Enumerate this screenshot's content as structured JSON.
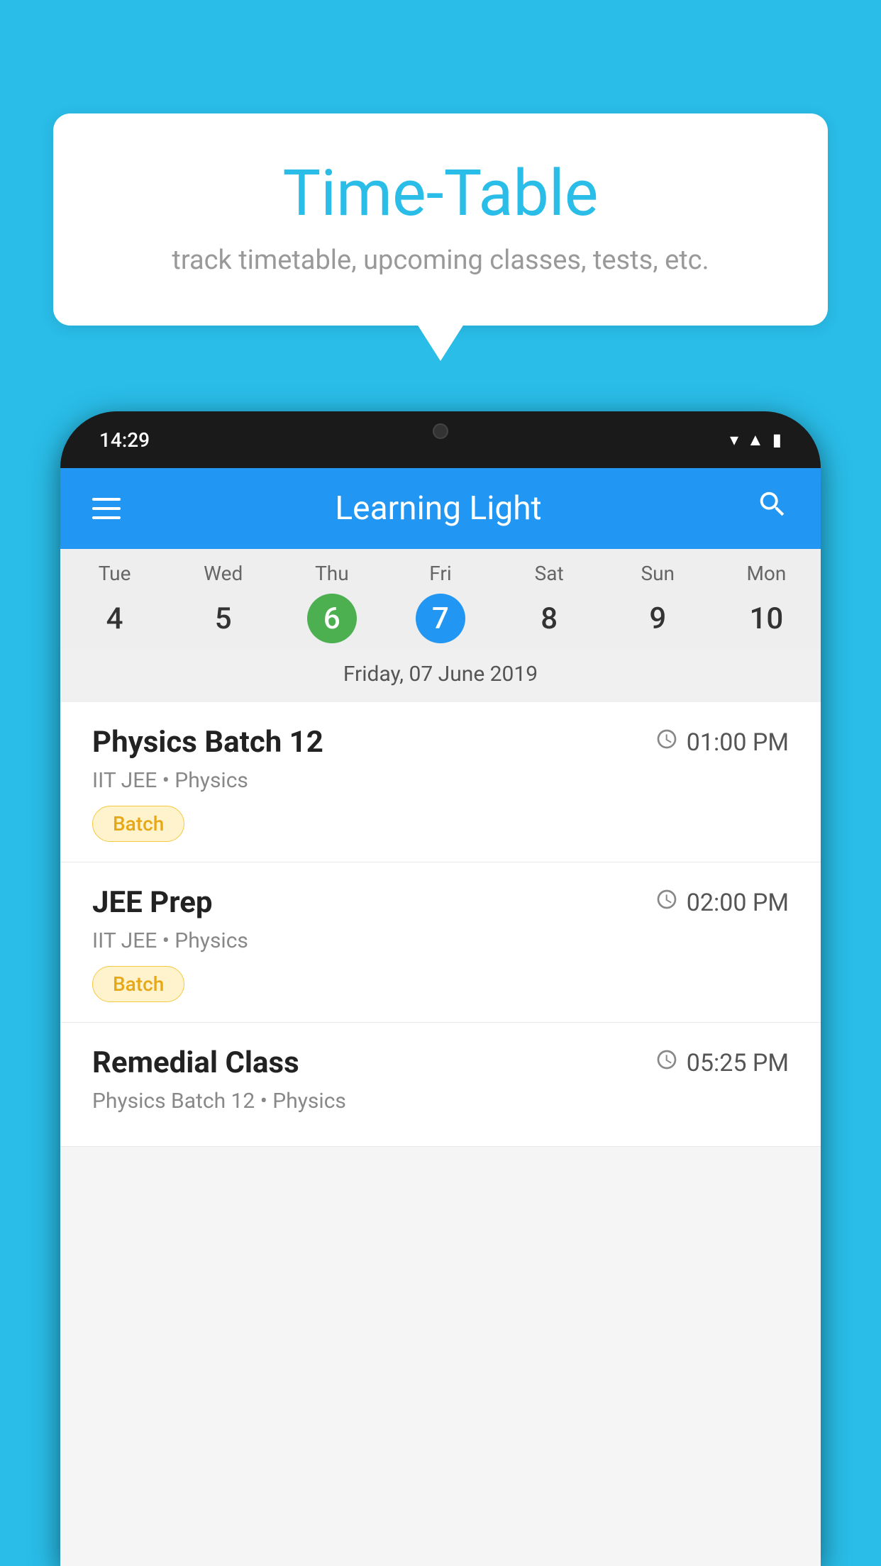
{
  "background_color": "#29bde8",
  "bubble": {
    "title": "Time-Table",
    "subtitle": "track timetable, upcoming classes, tests, etc."
  },
  "phone": {
    "status_bar": {
      "time": "14:29"
    },
    "app_header": {
      "title": "Learning Light"
    },
    "calendar": {
      "days": [
        {
          "name": "Tue",
          "number": "4",
          "state": "normal"
        },
        {
          "name": "Wed",
          "number": "5",
          "state": "normal"
        },
        {
          "name": "Thu",
          "number": "6",
          "state": "today"
        },
        {
          "name": "Fri",
          "number": "7",
          "state": "selected"
        },
        {
          "name": "Sat",
          "number": "8",
          "state": "normal"
        },
        {
          "name": "Sun",
          "number": "9",
          "state": "normal"
        },
        {
          "name": "Mon",
          "number": "10",
          "state": "normal"
        }
      ],
      "selected_date_label": "Friday, 07 June 2019"
    },
    "classes": [
      {
        "name": "Physics Batch 12",
        "time": "01:00 PM",
        "subtitle": "IIT JEE • Physics",
        "badge": "Batch"
      },
      {
        "name": "JEE Prep",
        "time": "02:00 PM",
        "subtitle": "IIT JEE • Physics",
        "badge": "Batch"
      },
      {
        "name": "Remedial Class",
        "time": "05:25 PM",
        "subtitle": "Physics Batch 12 • Physics",
        "badge": null
      }
    ]
  }
}
